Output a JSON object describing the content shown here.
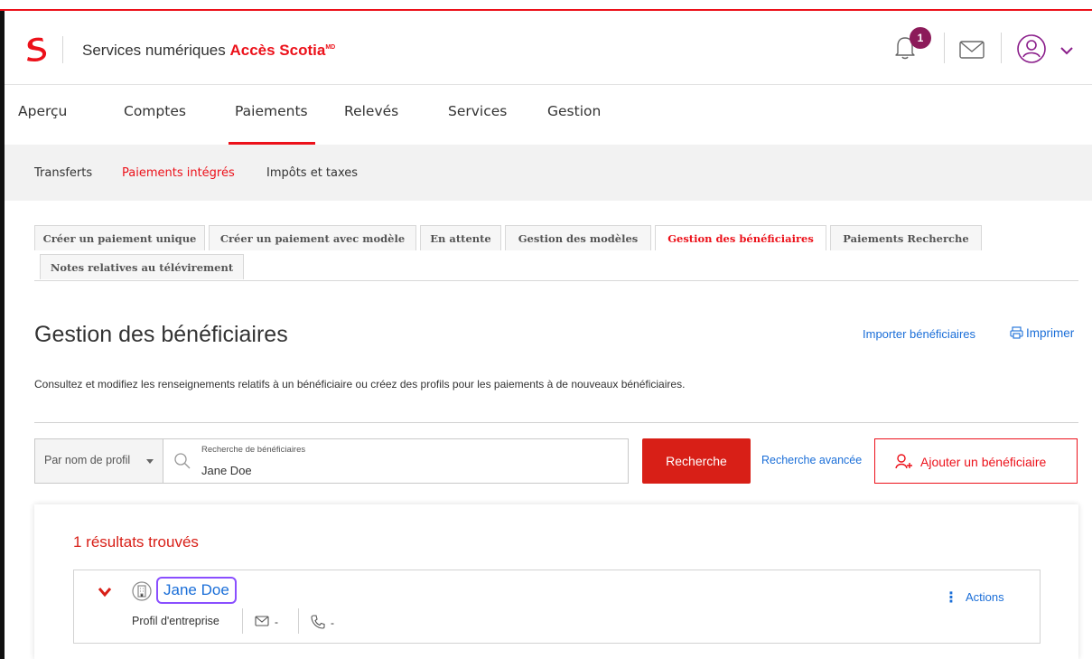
{
  "header": {
    "app_name_prefix": "Services numériques ",
    "app_name_brand": "Accès Scotia",
    "app_name_mark": "MD",
    "notification_count": "1"
  },
  "nav": {
    "items": [
      "Aperçu",
      "Comptes",
      "Paiements",
      "Relevés",
      "Services",
      "Gestion"
    ],
    "active": "Paiements"
  },
  "subnav": {
    "items": [
      "Transferts",
      "Paiements intégrés",
      "Impôts et taxes"
    ],
    "active": "Paiements intégrés"
  },
  "tabs": {
    "items": [
      "Créer un paiement unique",
      "Créer un paiement avec modèle",
      "En attente",
      "Gestion des modèles",
      "Gestion des bénéficiaires",
      "Paiements Recherche",
      "Notes relatives au télévirement"
    ],
    "active": "Gestion des bénéficiaires"
  },
  "page": {
    "title": "Gestion des bénéficiaires",
    "import_link": "Importer bénéficiaires",
    "print_link": "Imprimer",
    "description": "Consultez et modifiez les renseignements relatifs à un bénéficiaire ou créez des profils pour les paiements à de nouveaux bénéficiaires."
  },
  "search": {
    "filter_value": "Par nom de profil",
    "field_label": "Recherche de bénéficiaires",
    "field_value": "Jane Doe",
    "search_button": "Recherche",
    "advanced_link": "Recherche avancée",
    "add_button": "Ajouter un bénéficiaire"
  },
  "results": {
    "count_text": "1 résultats trouvés",
    "rows": [
      {
        "name": "Jane Doe",
        "type": "Profil d'entreprise",
        "email": "-",
        "phone": "-",
        "actions_label": "Actions"
      }
    ]
  },
  "colors": {
    "brand_red": "#ec111a",
    "link_blue": "#1a6ed8",
    "badge": "#8c1b5a",
    "focus_ring": "#8a4fff"
  }
}
